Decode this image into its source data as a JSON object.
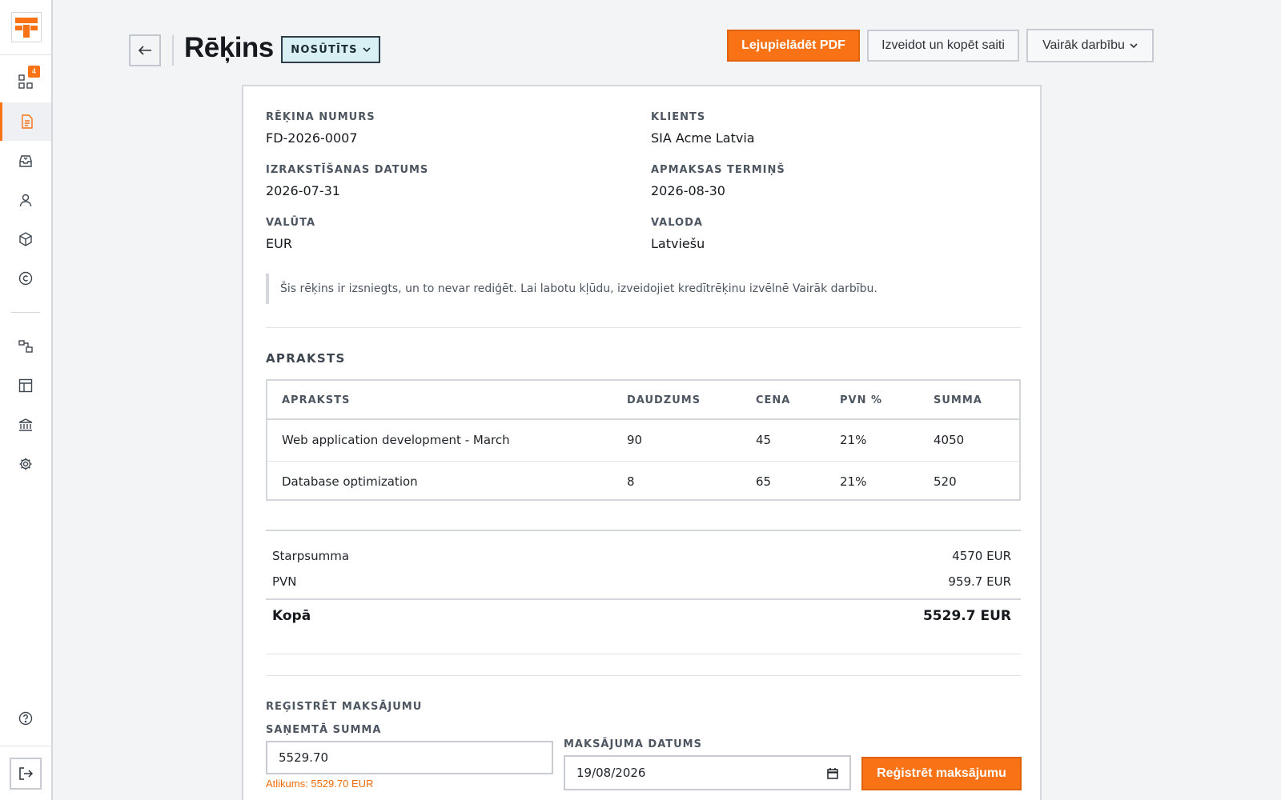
{
  "sidebar": {
    "badge_count": "4",
    "accent_color": "#f97316",
    "items": [
      {
        "name": "dashboard",
        "icon": "grid-icon"
      },
      {
        "name": "invoices",
        "icon": "document-icon",
        "active": true
      },
      {
        "name": "inbox",
        "icon": "inbox-icon"
      },
      {
        "name": "clients",
        "icon": "user-icon"
      },
      {
        "name": "products",
        "icon": "box-icon"
      },
      {
        "name": "copyright",
        "icon": "copyright-icon"
      },
      {
        "name": "integrations",
        "icon": "shapes-icon"
      },
      {
        "name": "templates",
        "icon": "layout-icon"
      },
      {
        "name": "bank",
        "icon": "bank-icon"
      },
      {
        "name": "settings",
        "icon": "gear-icon"
      },
      {
        "name": "help",
        "icon": "help-icon"
      },
      {
        "name": "logout",
        "icon": "logout-icon"
      }
    ]
  },
  "header": {
    "title": "Rēķins",
    "status": "NOSŪTĪTS",
    "download_pdf": "Lejupielādēt PDF",
    "create_link": "Izveidot un kopēt saiti",
    "more_actions": "Vairāk darbību"
  },
  "invoice": {
    "number_label": "RĒĶINA NUMURS",
    "number": "FD-2026-0007",
    "client_label": "KLIENTS",
    "client": "SIA Acme Latvia",
    "issue_date_label": "IZRAKSTĪŠANAS DATUMS",
    "issue_date": "2026-07-31",
    "due_label": "APMAKSAS TERMIŅŠ",
    "due_date": "2026-08-30",
    "currency_label": "VALŪTA",
    "currency": "EUR",
    "language_label": "VALODA",
    "language": "Latviešu",
    "notice": "Šis rēķins ir izsniegts, un to nevar rediģēt. Lai labotu kļūdu, izveidojiet kredītrēķinu izvēlnē Vairāk darbību."
  },
  "items_section": {
    "title": "APRAKSTS",
    "columns": [
      "APRAKSTS",
      "DAUDZUMS",
      "CENA",
      "PVN %",
      "SUMMA"
    ],
    "rows": [
      [
        "Web application development - March",
        "90",
        "45",
        "21%",
        "4050"
      ],
      [
        "Database optimization",
        "8",
        "65",
        "21%",
        "520"
      ]
    ]
  },
  "totals": {
    "subtotal_label": "Starpsumma",
    "subtotal": "4570 EUR",
    "vat_label": "PVN",
    "vat": "959.7 EUR",
    "total_label": "Kopā",
    "total": "5529.7 EUR"
  },
  "payment": {
    "title": "REĢISTRĒT MAKSĀJUMU",
    "amount_label": "SAŅEMTĀ SUMMA",
    "amount_value": "5529.70",
    "remaining_hint": "Atlikums: 5529.70 EUR",
    "date_label": "MAKSĀJUMA DATUMS",
    "date_value": "19/08/2026",
    "submit": "Reģistrēt maksājumu"
  }
}
